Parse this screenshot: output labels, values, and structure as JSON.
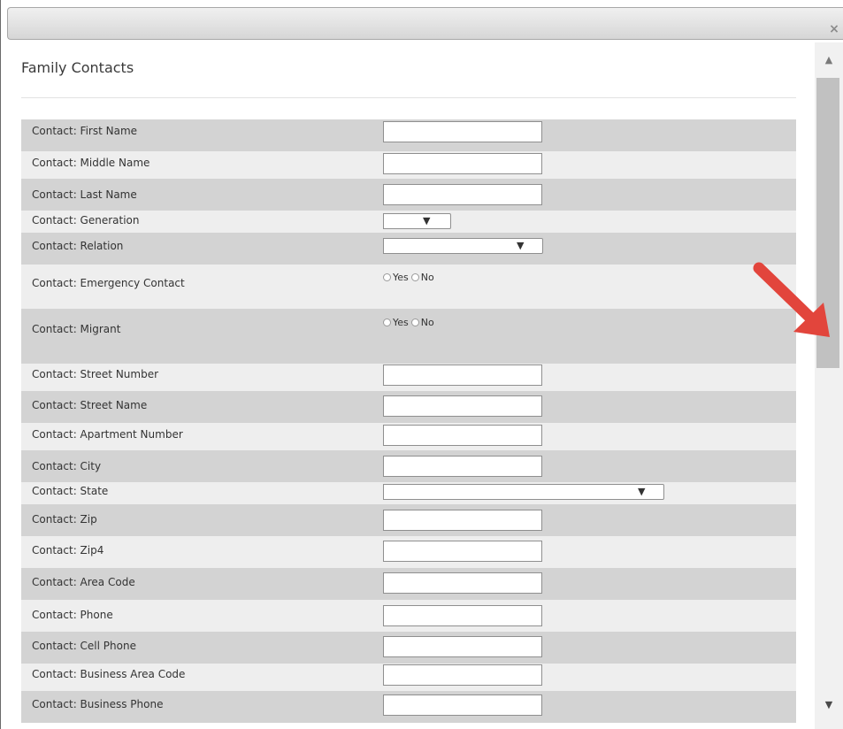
{
  "dialog": {
    "close_label": "×"
  },
  "section": {
    "title": "Family Contacts"
  },
  "radio_options": {
    "yes": "Yes",
    "no": "No"
  },
  "rows": [
    {
      "label": "Contact: First Name",
      "type": "text",
      "value": ""
    },
    {
      "label": "Contact: Middle Name",
      "type": "text",
      "value": ""
    },
    {
      "label": "Contact: Last Name",
      "type": "text",
      "value": ""
    },
    {
      "label": "Contact: Generation",
      "type": "select-small",
      "value": ""
    },
    {
      "label": "Contact: Relation",
      "type": "select-medium",
      "value": ""
    },
    {
      "label": "Contact: Emergency Contact",
      "type": "radio",
      "value": ""
    },
    {
      "label": "Contact: Migrant",
      "type": "radio",
      "value": ""
    },
    {
      "label": "Contact: Street Number",
      "type": "text",
      "value": ""
    },
    {
      "label": "Contact: Street Name",
      "type": "text",
      "value": ""
    },
    {
      "label": "Contact: Apartment Number",
      "type": "text",
      "value": ""
    },
    {
      "label": "Contact: City",
      "type": "text",
      "value": ""
    },
    {
      "label": "Contact: State",
      "type": "select-large",
      "value": ""
    },
    {
      "label": "Contact: Zip",
      "type": "text",
      "value": ""
    },
    {
      "label": "Contact: Zip4",
      "type": "text",
      "value": ""
    },
    {
      "label": "Contact: Area Code",
      "type": "text",
      "value": ""
    },
    {
      "label": "Contact: Phone",
      "type": "text",
      "value": ""
    },
    {
      "label": "Contact: Cell Phone",
      "type": "text",
      "value": ""
    },
    {
      "label": "Contact: Business Area Code",
      "type": "text",
      "value": ""
    },
    {
      "label": "Contact: Business Phone",
      "type": "text",
      "value": ""
    }
  ],
  "icons": {
    "close": "close-icon",
    "scroll_up": "scroll-up-arrow-icon",
    "scroll_down": "scroll-down-arrow-icon",
    "dropdown": "dropdown-arrow-icon",
    "annotation": "red-pointer-arrow-icon"
  },
  "colors": {
    "row_shade": "#d3d3d3",
    "row_light": "#eeeeee",
    "annotation_arrow": "#e2453c"
  }
}
